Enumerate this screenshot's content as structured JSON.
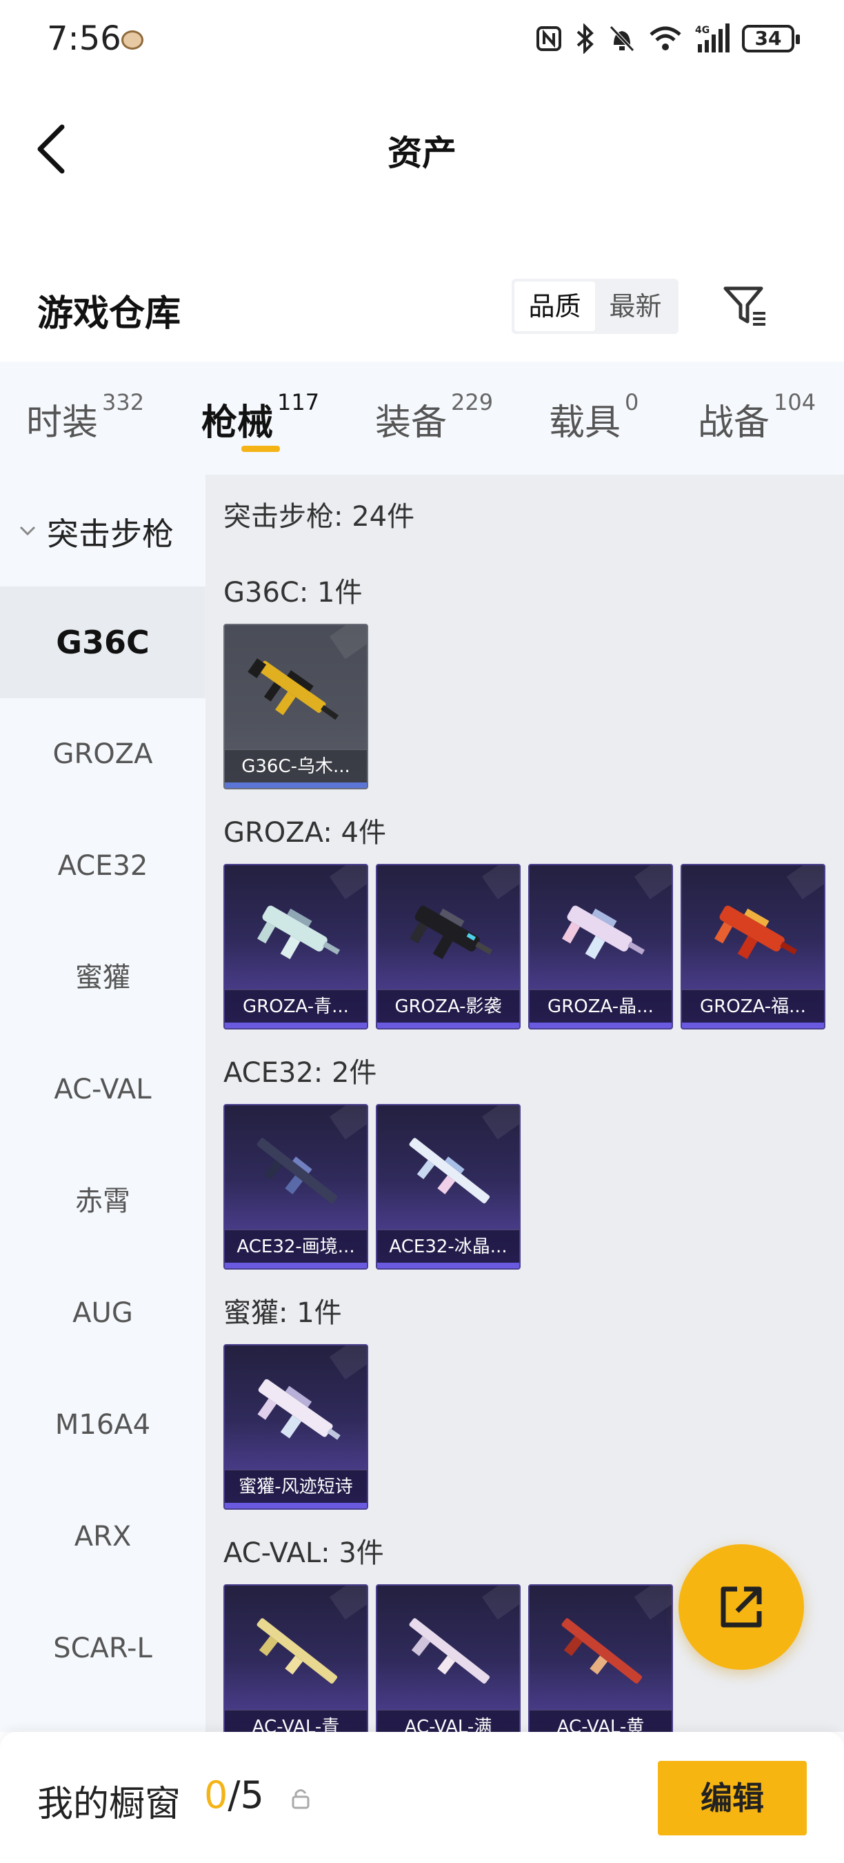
{
  "status_bar": {
    "time": "7:56",
    "battery": "34"
  },
  "header": {
    "title": "资产"
  },
  "warehouse": {
    "title": "游戏仓库",
    "sort_options": [
      "品质",
      "最新"
    ],
    "active_sort": "品质"
  },
  "tabs": [
    {
      "label": "时装",
      "count": "332"
    },
    {
      "label": "枪械",
      "count": "117"
    },
    {
      "label": "装备",
      "count": "229"
    },
    {
      "label": "载具",
      "count": "0"
    },
    {
      "label": "战备",
      "count": "104"
    }
  ],
  "active_tab": "枪械",
  "sidebar": {
    "group": "突击步枪",
    "items": [
      "G36C",
      "GROZA",
      "ACE32",
      "蜜獾",
      "AC-VAL",
      "赤霄",
      "AUG",
      "M16A4",
      "ARX",
      "SCAR-L"
    ],
    "active": "G36C"
  },
  "content": {
    "category_summary": "突击步枪: 24件",
    "sections": [
      {
        "heading": "G36C: 1件",
        "items": [
          "G36C-乌木..."
        ]
      },
      {
        "heading": "GROZA: 4件",
        "items": [
          "GROZA-青...",
          "GROZA-影袭",
          "GROZA-晶...",
          "GROZA-福..."
        ]
      },
      {
        "heading": "ACE32: 2件",
        "items": [
          "ACE32-画境...",
          "ACE32-冰晶..."
        ]
      },
      {
        "heading": "蜜獾: 1件",
        "items": [
          "蜜獾-风迹短诗"
        ]
      },
      {
        "heading": "AC-VAL: 3件",
        "items": [
          "AC-VAL-青",
          "AC-VAL-满",
          "AC-VAL-黄"
        ]
      }
    ]
  },
  "showcase": {
    "title": "我的橱窗",
    "current": "0",
    "max": "/5",
    "edit_label": "编辑"
  },
  "colors": {
    "accent": "#f7b512",
    "tab_underline": "#f5b416",
    "card_purple": "#2f2a5a",
    "card_gray": "#50535d"
  },
  "icons": [
    "nfc-icon",
    "bluetooth-icon",
    "mute-icon",
    "wifi-icon",
    "signal-icon",
    "battery-icon",
    "back-arrow-icon",
    "filter-icon",
    "chevron-down-icon",
    "share-external-icon",
    "lock-icon"
  ]
}
